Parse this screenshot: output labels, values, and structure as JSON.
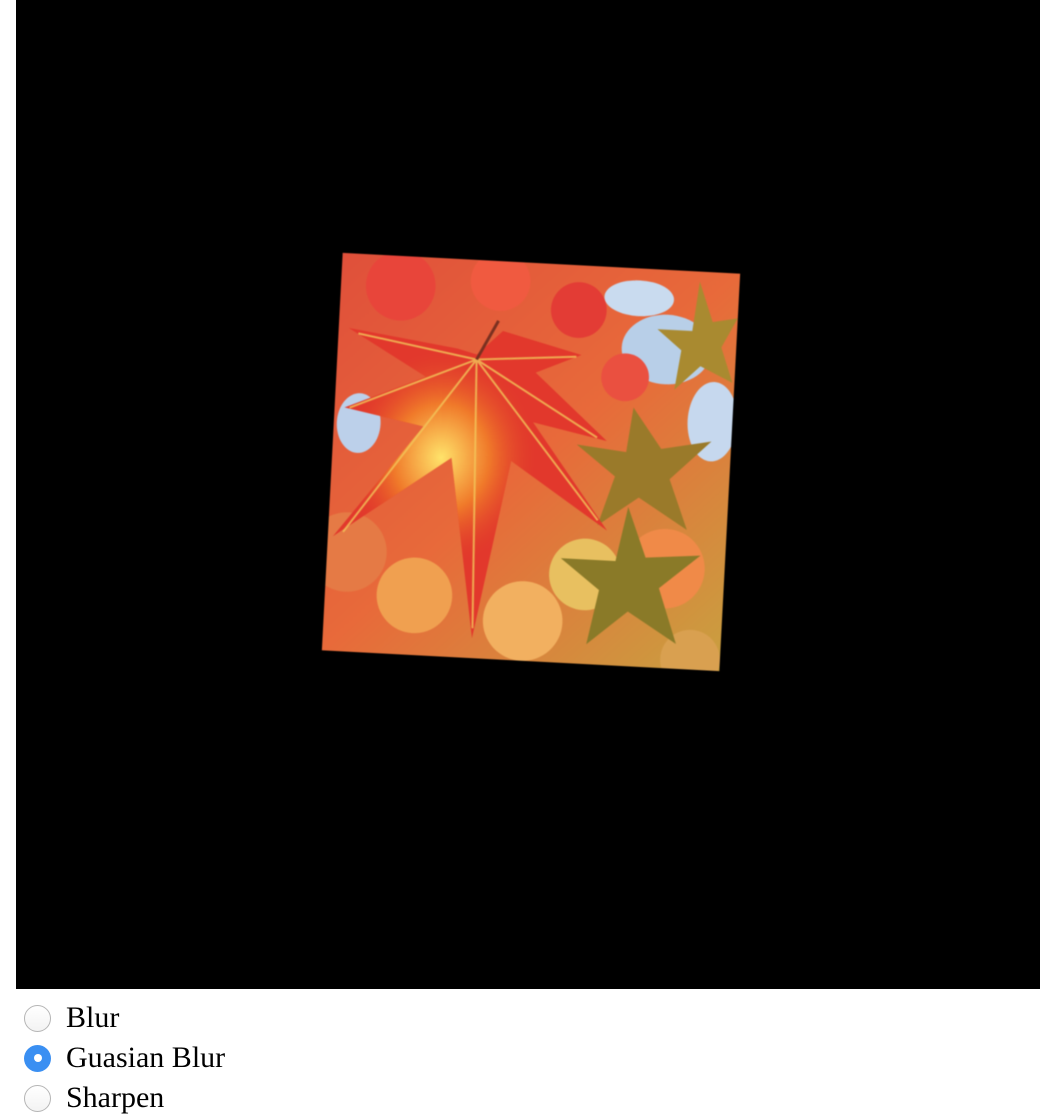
{
  "filter_options": [
    {
      "label": "Blur",
      "checked": false
    },
    {
      "label": "Guasian Blur",
      "checked": true
    },
    {
      "label": "Sharpen",
      "checked": false
    }
  ],
  "colors": {
    "canvas_background": "#000000",
    "radio_selected": "#3a8ff2"
  },
  "image": {
    "subject": "red autumn maple leaves",
    "rotation_degrees": 3
  }
}
